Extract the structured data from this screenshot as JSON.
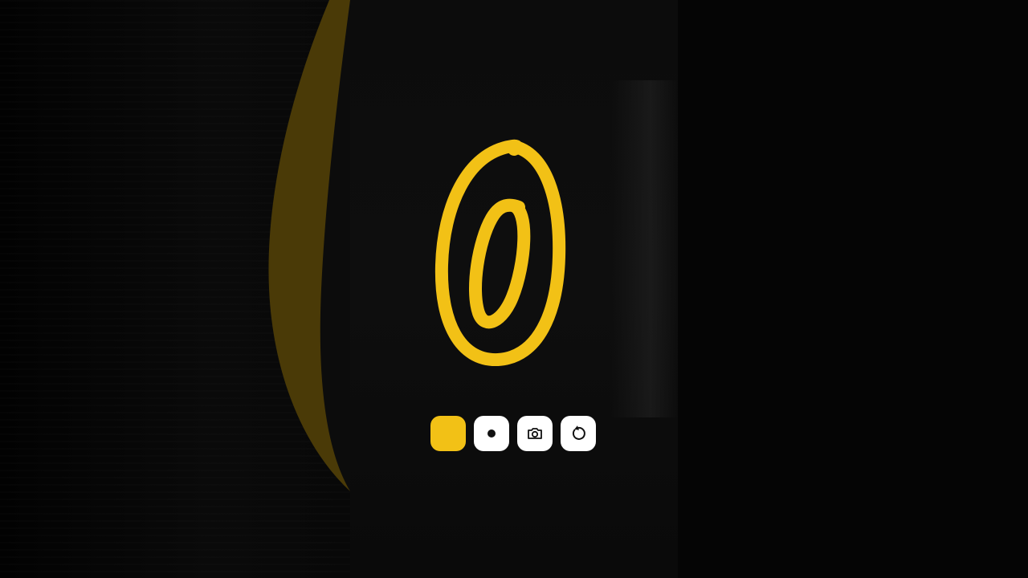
{
  "app": {
    "background_color": "#050505",
    "panel_color": "#0d0d0d",
    "accent_color": "#f2c116",
    "decor_arc_color": "#4a3a07"
  },
  "canvas": {
    "drawn_glyph": "0",
    "stroke_color": "#f2c116"
  },
  "toolbar": {
    "buttons": [
      {
        "name": "color-swatch",
        "icon": "yellow-swatch",
        "color": "#f2c116"
      },
      {
        "name": "brush-size",
        "icon": "dot-icon"
      },
      {
        "name": "camera",
        "icon": "camera-icon"
      },
      {
        "name": "undo",
        "icon": "undo-icon"
      }
    ]
  }
}
